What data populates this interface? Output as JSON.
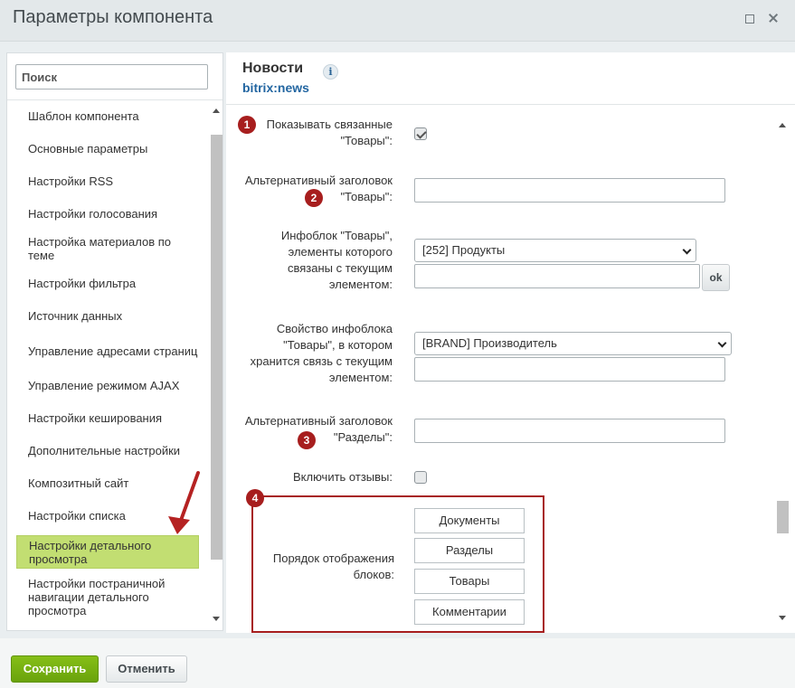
{
  "window": {
    "title": "Параметры компонента"
  },
  "sidebar": {
    "search_placeholder": "Поиск",
    "items": [
      {
        "label": "Шаблон компонента"
      },
      {
        "label": "Основные параметры"
      },
      {
        "label": "Настройки RSS"
      },
      {
        "label": "Настройки голосования"
      },
      {
        "label": "Настройка материалов по теме"
      },
      {
        "label": "Настройки фильтра"
      },
      {
        "label": "Источник данных"
      },
      {
        "label": "Управление адресами страниц"
      },
      {
        "label": "Управление режимом AJAX"
      },
      {
        "label": "Настройки кеширования"
      },
      {
        "label": "Дополнительные настройки"
      },
      {
        "label": "Композитный сайт"
      },
      {
        "label": "Настройки списка"
      },
      {
        "label": "Настройки детального просмотра",
        "active": true
      },
      {
        "label": "Настройки постраничной навигации детального просмотра"
      }
    ]
  },
  "component": {
    "name": "Новости",
    "info_icon": "i",
    "code": "bitrix:news"
  },
  "fields": {
    "show_related": {
      "label": "Показывать связанные \"Товары\":",
      "checked": true,
      "badge": "1"
    },
    "alt_title_goods": {
      "label": "Альтернативный заголовок \"Товары\":",
      "value": "",
      "badge": "2"
    },
    "iblock_goods": {
      "label": "Инфоблок \"Товары\", элементы которого связаны с текущим элементом:",
      "selected": "[252] Продукты",
      "extra_value": "",
      "ok_label": "ok"
    },
    "iblock_property": {
      "label": "Свойство инфоблока \"Товары\", в котором хранится связь с текущим элементом:",
      "selected": "[BRAND] Производитель",
      "extra_value": ""
    },
    "alt_title_sections": {
      "label": "Альтернативный заголовок \"Разделы\":",
      "value": "",
      "badge": "3"
    },
    "enable_reviews": {
      "label": "Включить отзывы:",
      "checked": false
    },
    "blocks_order": {
      "label": "Порядок отображения блоков:",
      "badge": "4",
      "items": [
        "Документы",
        "Разделы",
        "Товары",
        "Комментарии"
      ]
    }
  },
  "footer": {
    "save_label": "Сохранить",
    "cancel_label": "Отменить"
  },
  "colors": {
    "accent_green": "#86bf17",
    "active_item": "#c2de72",
    "annotation_red": "#a71e1e",
    "link_blue": "#2366a1"
  }
}
